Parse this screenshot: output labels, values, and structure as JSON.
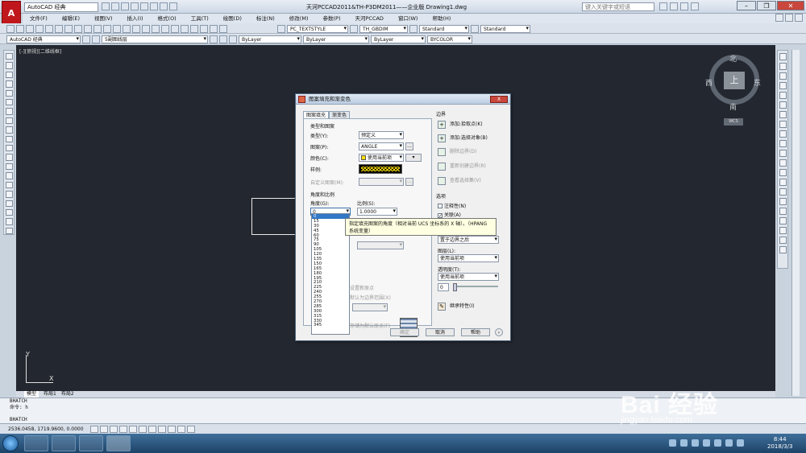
{
  "app": {
    "logo": "A",
    "workspace": "AutoCAD 经典",
    "window_title": "天河PCCAD2011&TH-P3DM2011——企业版      Drawing1.dwg",
    "search_placeholder": "键入关键字或短语"
  },
  "menu": [
    "文件(F)",
    "编辑(E)",
    "视图(V)",
    "插入(I)",
    "格式(O)",
    "工具(T)",
    "绘图(D)",
    "标注(N)",
    "修改(M)",
    "参数(P)",
    "天河PCCAD",
    "窗口(W)",
    "帮助(H)"
  ],
  "toolbar": {
    "text_style": "PC_TEXTSTYLE",
    "dim_style": "TH_GBDIM",
    "table_style": "Standard",
    "multileader_style": "Standard",
    "workspace2": "AutoCAD 经典",
    "layer": "5副图线层",
    "color": "ByLayer",
    "linetype": "ByLayer",
    "lineweight": "ByLayer",
    "plot_style": "BYCOLOR"
  },
  "canvas": {
    "view_label": "[-][俯视][二维线框]",
    "viewcube": {
      "north": "北",
      "south": "南",
      "east": "东",
      "west": "西",
      "top": "上",
      "wcs": "WCS"
    },
    "ucs_x": "X",
    "ucs_y": "Y"
  },
  "layout_tabs": [
    "模型",
    "布局1",
    "布局2"
  ],
  "command": {
    "line1": "BHATCH",
    "line2": "命令: h",
    "line3": "BHATCH"
  },
  "status": {
    "coords": "2536.0458,  1719.9600,  0.0000"
  },
  "clock": {
    "time": "8:44",
    "date": "2018/3/3"
  },
  "dialog": {
    "title": "图案填充和渐变色",
    "close": "X",
    "tabs": [
      "图案填充",
      "渐变色"
    ],
    "type_pattern": {
      "section": "类型和图案",
      "type_label": "类型(Y):",
      "type_value": "预定义",
      "pattern_label": "图案(P):",
      "pattern_value": "ANGLE",
      "color_label": "颜色(C):",
      "color_value": "使用当前项",
      "swatch_label": "样例:",
      "custom_label": "自定义图案(M):"
    },
    "angle_scale": {
      "section": "角度和比例",
      "angle_label": "角度(G):",
      "angle_value": "0",
      "scale_label": "比例(S):",
      "scale_value": "1.0000"
    },
    "angle_options": [
      "0",
      "15",
      "30",
      "45",
      "60",
      "75",
      "90",
      "105",
      "120",
      "135",
      "150",
      "165",
      "180",
      "195",
      "210",
      "225",
      "240",
      "255",
      "270",
      "285",
      "300",
      "315",
      "330",
      "345"
    ],
    "tooltip": "指定填充图案的角度（相对当前 UCS 坐标系的 X 轴）。（HPANG 系统变量）",
    "origin": {
      "use_current": "设置新原点",
      "default_extent": "默认为边界范围(X)",
      "store_default": "存储为默认原点(F)"
    },
    "boundaries": {
      "section": "边界",
      "add_pick": "添加:拾取点(K)",
      "add_select": "添加:选择对象(B)",
      "remove": "删除边界(D)",
      "recreate": "重新创建边界(R)",
      "view_sel": "查看选择集(V)"
    },
    "options": {
      "section": "选项",
      "annotative": "注释性(N)",
      "associative": "关联(A)",
      "draw_order_value": "置于边界之后",
      "layer_label": "图层(L):",
      "layer_value": "使用当前项",
      "transparency_label": "透明度(T):",
      "transparency_value": "使用当前项",
      "transparency_amount": "0",
      "inherit": "继承特性(I)"
    },
    "buttons": {
      "ok": "确定",
      "cancel": "取消",
      "help": "帮助"
    }
  },
  "watermark": {
    "main": "Bai 经验",
    "sub": "jingyan.baidu.com"
  }
}
